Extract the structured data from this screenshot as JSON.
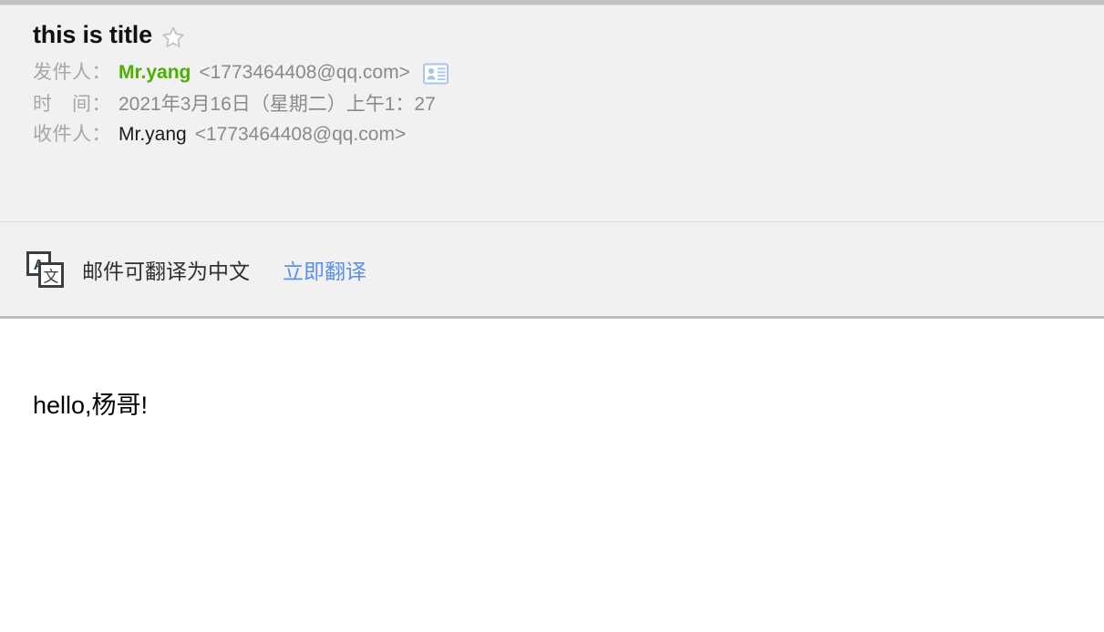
{
  "mail": {
    "subject": "this is title",
    "star_icon": "star-outline-icon",
    "sender": {
      "label": "发件人：",
      "name": "Mr.yang",
      "address": "<1773464408@qq.com>",
      "contact_icon": "contact-card-icon"
    },
    "time": {
      "label": "时　间：",
      "value": "2021年3月16日（星期二）上午1：27"
    },
    "recipient": {
      "label": "收件人：",
      "name": "Mr.yang",
      "address": "<1773464408@qq.com>"
    },
    "translate": {
      "icon": "translate-icon",
      "notice": "邮件可翻译为中文",
      "action_label": "立即翻译"
    },
    "body": {
      "text": "hello,杨哥!"
    },
    "colors": {
      "header_bg": "#f1f1f1",
      "sender_name": "#4caf00",
      "link": "#5b8fe8",
      "label": "#a6a6a6",
      "value": "#8a8a8a",
      "divider": "#bdbdbd"
    }
  }
}
